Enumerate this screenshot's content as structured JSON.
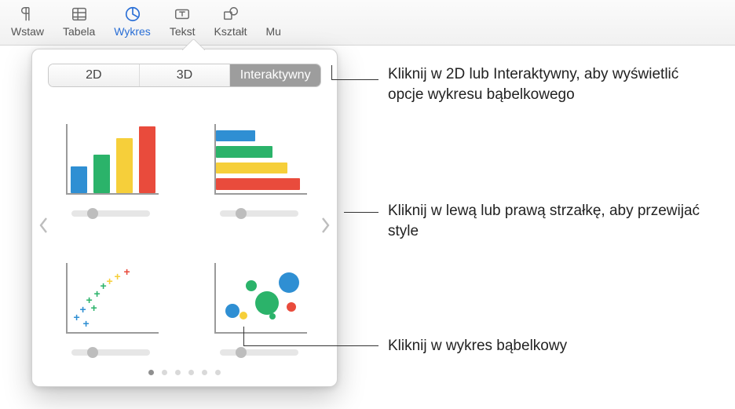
{
  "toolbar": {
    "items": [
      {
        "label": "Wstaw",
        "icon": "pilcrow"
      },
      {
        "label": "Tabela",
        "icon": "table"
      },
      {
        "label": "Wykres",
        "icon": "pie",
        "selected": true
      },
      {
        "label": "Tekst",
        "icon": "textbox"
      },
      {
        "label": "Kształt",
        "icon": "shapes"
      },
      {
        "label": "Mu",
        "icon": ""
      }
    ]
  },
  "segmented": {
    "tabs": [
      "2D",
      "3D",
      "Interaktywny"
    ],
    "selected_index": 2
  },
  "pager": {
    "count": 6,
    "active": 0
  },
  "callouts": {
    "tabs": "Kliknij w 2D lub Interaktywny, aby wyświetlić opcje wykresu bąbelkowego",
    "arrows": "Kliknij w lewą lub prawą strzałkę, aby przewijać style",
    "bubble": "Kliknij w wykres bąbelkowy"
  },
  "thumbs": {
    "names": [
      "bar-vertical",
      "bar-horizontal",
      "scatter-plus",
      "bubble"
    ]
  }
}
